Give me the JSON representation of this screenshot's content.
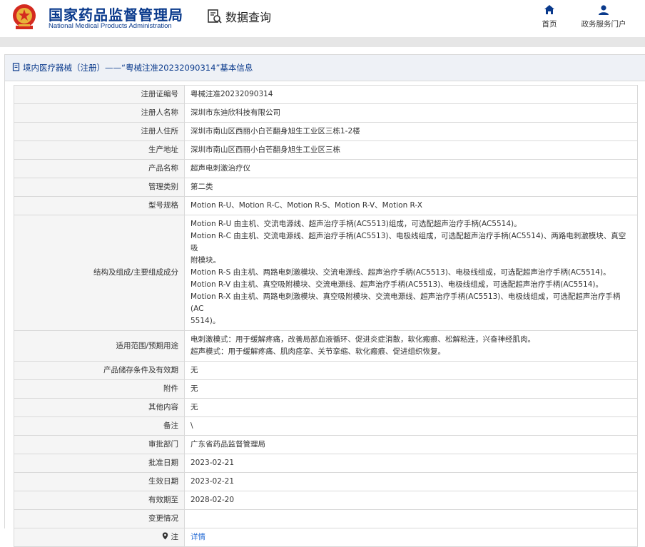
{
  "header": {
    "title_cn": "国家药品监督管理局",
    "title_en": "National Medical Products Administration",
    "search_label": "数据查询",
    "nav": [
      {
        "label": "首页",
        "icon": "home-icon"
      },
      {
        "label": "政务服务门户",
        "icon": "user-icon"
      }
    ]
  },
  "panel": {
    "heading": "境内医疗器械（注册）——“粤械注准20232090314”基本信息"
  },
  "rows": [
    {
      "label": "注册证编号",
      "value": "粤械注准20232090314"
    },
    {
      "label": "注册人名称",
      "value": "深圳市东迪欣科技有限公司"
    },
    {
      "label": "注册人住所",
      "value": "深圳市南山区西丽小白芒翻身旭生工业区三栋1-2楼"
    },
    {
      "label": "生产地址",
      "value": "深圳市南山区西丽小白芒翻身旭生工业区三栋"
    },
    {
      "label": "产品名称",
      "value": "超声电刺激治疗仪"
    },
    {
      "label": "管理类别",
      "value": "第二类"
    },
    {
      "label": "型号规格",
      "value": "Motion R-U、Motion R-C、Motion R-S、Motion R-V、Motion R-X"
    },
    {
      "label": "结构及组成/主要组成成分",
      "lines": [
        "Motion R-U 由主机、交流电源线、超声治疗手柄(AC5513)组成，可选配超声治疗手柄(AC5514)。",
        "Motion R-C 由主机、交流电源线、超声治疗手柄(AC5513)、电极线组成，可选配超声治疗手柄(AC5514)、两路电刺激模块、真空吸",
        "附模块。",
        "Motion R-S 由主机、两路电刺激模块、交流电源线、超声治疗手柄(AC5513)、电极线组成，可选配超声治疗手柄(AC5514)。",
        "Motion R-V 由主机、真空吸附模块、交流电源线、超声治疗手柄(AC5513)、电极线组成，可选配超声治疗手柄(AC5514)。",
        "Motion R-X 由主机、两路电刺激模块、真空吸附模块、交流电源线、超声治疗手柄(AC5513)、电极线组成，可选配超声治疗手柄(AC",
        "5514)。"
      ]
    },
    {
      "label": "适用范围/预期用途",
      "lines": [
        "电刺激模式：用于缓解疼痛，改善局部血液循环、促进炎症消散，软化瘢痕、松解粘连，兴奋神经肌肉。",
        "超声模式：用于缓解疼痛、肌肉痉挛、关节挛缩、软化瘢痕、促进组织恢复。"
      ]
    },
    {
      "label": "产品储存条件及有效期",
      "value": "无"
    },
    {
      "label": "附件",
      "value": "无"
    },
    {
      "label": "其他内容",
      "value": "无"
    },
    {
      "label": "备注",
      "value": "\\"
    },
    {
      "label": "审批部门",
      "value": "广东省药品监督管理局"
    },
    {
      "label": "批准日期",
      "value": "2023-02-21"
    },
    {
      "label": "生效日期",
      "value": "2023-02-21"
    },
    {
      "label": "有效期至",
      "value": "2028-02-20"
    },
    {
      "label": "变更情况",
      "value": ""
    },
    {
      "label": "注",
      "value": "详情",
      "icon": "pin-icon"
    }
  ]
}
